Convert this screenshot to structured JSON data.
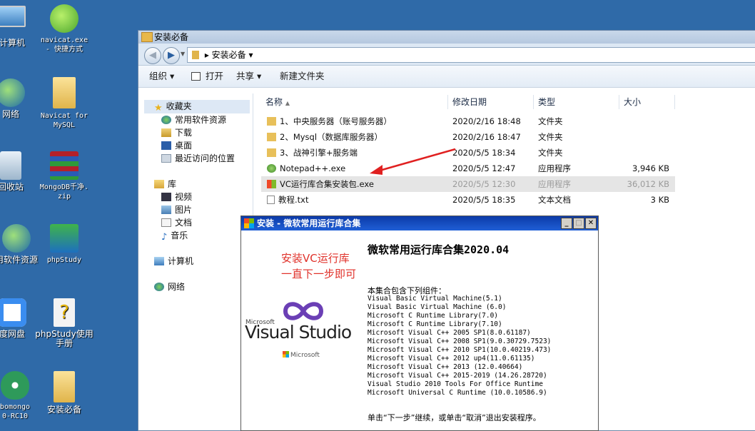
{
  "desktop": {
    "icons": [
      {
        "label": "计算机"
      },
      {
        "label": "navicat.exe\n- 快捷方式"
      },
      {
        "label": "网络"
      },
      {
        "label": "Navicat for\nMySQL"
      },
      {
        "label": "回收站"
      },
      {
        "label": "MongoDB千净.\nzip"
      },
      {
        "label": "用软件资源"
      },
      {
        "label": "phpStudy"
      },
      {
        "label": "度网盘"
      },
      {
        "label": "phpStudy使用\n手册"
      },
      {
        "label": "bomongo\n0-RC10"
      },
      {
        "label": "安装必备"
      }
    ]
  },
  "explorer": {
    "title": "安装必备",
    "address": "▸ 安装必备 ▾",
    "toolbar": {
      "organize": "组织 ▾",
      "open": "打开",
      "share": "共享 ▾",
      "new_folder": "新建文件夹"
    },
    "nav": {
      "favorites": "收藏夹",
      "fav_items": [
        "常用软件资源",
        "下载",
        "桌面",
        "最近访问的位置"
      ],
      "libraries": "库",
      "lib_items": [
        "视频",
        "图片",
        "文档",
        "音乐"
      ],
      "computer": "计算机",
      "network": "网络"
    },
    "columns": {
      "name": "名称",
      "date": "修改日期",
      "type": "类型",
      "size": "大小"
    },
    "files": [
      {
        "name": "1、中央服务器（账号服务器）",
        "date": "2020/2/16 18:48",
        "type": "文件夹",
        "size": ""
      },
      {
        "name": "2、Mysql（数据库服务器）",
        "date": "2020/2/16 18:47",
        "type": "文件夹",
        "size": ""
      },
      {
        "name": "3、战神引擎+服务端",
        "date": "2020/5/5 18:34",
        "type": "文件夹",
        "size": ""
      },
      {
        "name": "Notepad++.exe",
        "date": "2020/5/5 12:47",
        "type": "应用程序",
        "size": "3,946 KB"
      },
      {
        "name": "VC运行库合集安装包.exe",
        "date": "2020/5/5 12:30",
        "type": "应用程序",
        "size": "36,012 KB"
      },
      {
        "name": "教程.txt",
        "date": "2020/5/5 18:35",
        "type": "文本文档",
        "size": "3 KB"
      }
    ]
  },
  "installer": {
    "title": "安装 - 微软常用运行库合集",
    "heading": "微软常用运行库合集2020.04",
    "annotation_line1": "安装VC运行库",
    "annotation_line2": "一直下一步即可",
    "logo_small": "Microsoft",
    "logo_text": "Visual Studio",
    "brand": "Microsoft",
    "intro": "本集合包含下列组件：",
    "components": [
      "Visual Basic Virtual Machine(5.1)",
      "Visual Basic Virtual Machine (6.0)",
      "Microsoft C Runtime Library(7.0)",
      "Microsoft C Runtime Library(7.10)",
      "Microsoft Visual C++ 2005 SP1(8.0.61187)",
      "Microsoft Visual C++ 2008 SP1(9.0.30729.7523)",
      "Microsoft Visual C++ 2010 SP1(10.0.40219.473)",
      "Microsoft Visual C++ 2012 up4(11.0.61135)",
      "Microsoft Visual C++ 2013 (12.0.40664)",
      "Microsoft Visual C++ 2015-2019 (14.26.28720)",
      "Visual Studio 2010 Tools For Office Runtime",
      "Microsoft Universal C Runtime (10.0.10586.9)"
    ],
    "footer": "单击“下一步”继续，或单击“取消”退出安装程序。"
  }
}
